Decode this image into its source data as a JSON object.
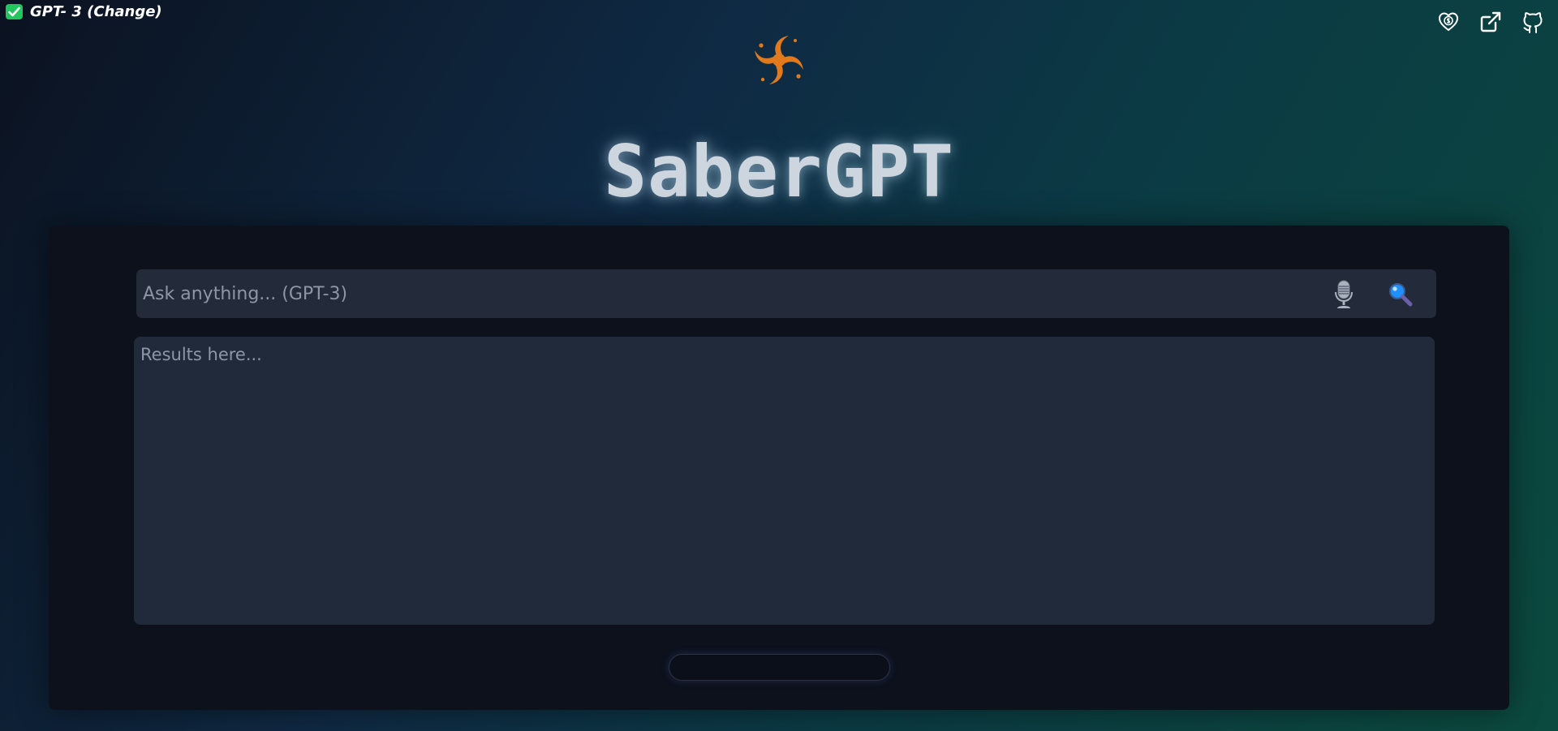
{
  "model_switch": {
    "label": "GPT- 3 (Change)",
    "checked": true
  },
  "header": {
    "icons": [
      "donate-heart-icon",
      "external-link-icon",
      "github-icon"
    ],
    "title": "SaberGPT",
    "logo": "orange-spiral-logo"
  },
  "search": {
    "placeholder": "Ask anything... (GPT-3)",
    "value": "",
    "mic_icon": "microphone-icon",
    "search_icon": "magnifier-icon"
  },
  "results": {
    "placeholder": "Results here...",
    "value": ""
  },
  "colors": {
    "accent_logo": "#e07a1c",
    "panel_bg": "#0c111c",
    "input_bg": "#232b3a",
    "check_green": "#22c55e"
  }
}
